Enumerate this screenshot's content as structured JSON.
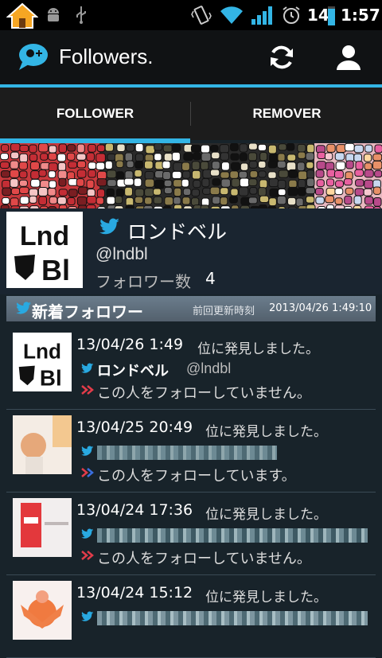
{
  "status_bar": {
    "battery_level": "14",
    "time": "1:57",
    "icons": [
      "home-icon",
      "android-debug-icon",
      "usb-icon",
      "vibrate-icon",
      "wifi-icon",
      "signal-icon",
      "alarm-icon",
      "battery-icon"
    ]
  },
  "action_bar": {
    "title": "Followers.",
    "icons": [
      "app-logo-icon",
      "refresh-icon",
      "person-icon"
    ]
  },
  "tabs": [
    {
      "label": "FOLLOWER",
      "selected": true
    },
    {
      "label": "REMOVER",
      "selected": false
    }
  ],
  "profile": {
    "name": "ロンドベル",
    "handle": "@lndbl",
    "follower_count_label": "フォロワー数",
    "follower_count": "4"
  },
  "section": {
    "title": "新着フォロワー",
    "last_update_label": "前回更新時刻",
    "last_update_time": "2013/04/26 1:49:10"
  },
  "followers": [
    {
      "date": "13/04/26 1:49",
      "found_text": "位に発見しました。",
      "name": "ロンドベル",
      "handle": "@lndbl",
      "status": "この人をフォローしていません。"
    },
    {
      "date": "13/04/25 20:49",
      "found_text": "位に発見しました。",
      "name": "",
      "handle": "",
      "status": "この人をフォローしています。"
    },
    {
      "date": "13/04/24 17:36",
      "found_text": "位に発見しました。",
      "name": "",
      "handle": "",
      "status": "この人をフォローしていません。"
    },
    {
      "date": "13/04/24 15:12",
      "found_text": "位に発見しました。",
      "name": "",
      "handle": "",
      "status": ""
    }
  ],
  "colors": {
    "accent": "#33b5e5",
    "background": "#18232a",
    "twitter_blue": "#29a9e1"
  }
}
